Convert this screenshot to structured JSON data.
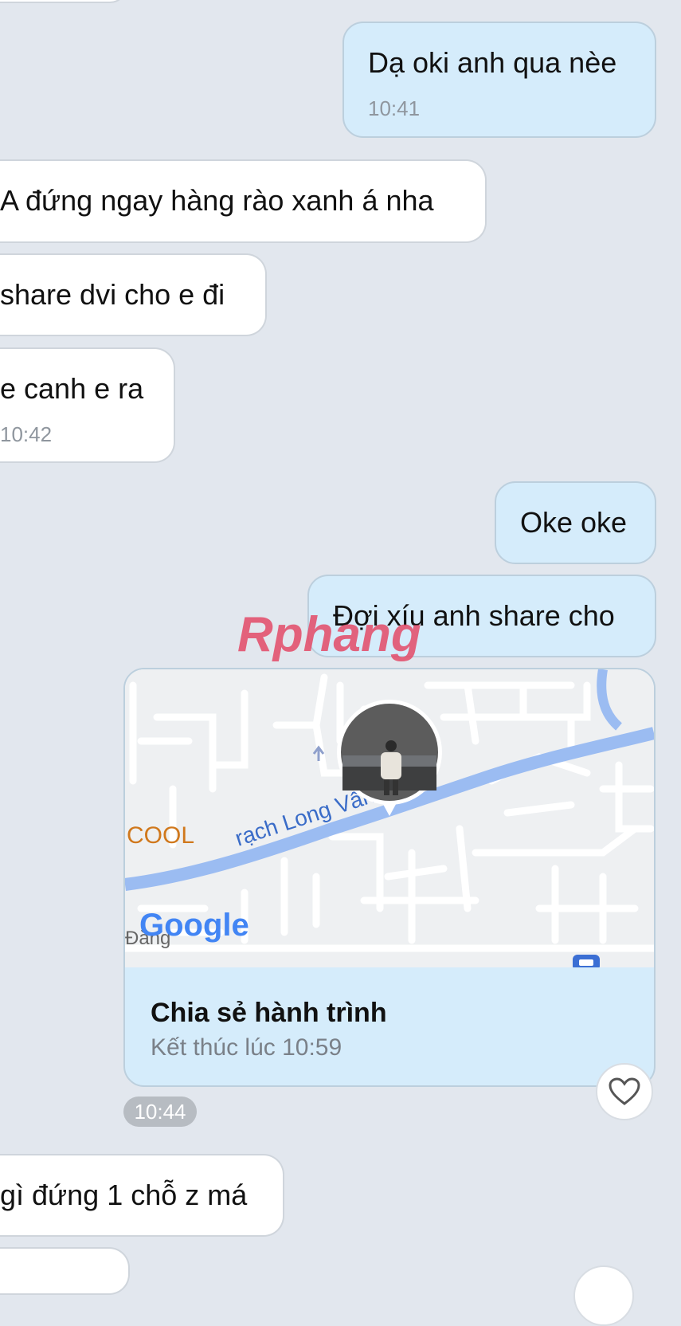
{
  "messages": [
    {
      "text": "Dạ oki anh qua nèe",
      "time": "10:41"
    },
    {
      "text": "A đứng ngay hàng rào xanh á nha"
    },
    {
      "text": "share dvi cho e đi"
    },
    {
      "text": "e canh e ra",
      "time": "10:42"
    },
    {
      "text": "Oke oke"
    },
    {
      "text": "Đợi xíu anh share cho"
    },
    {
      "text": "gì đứng 1 chỗ z má"
    }
  ],
  "location_card": {
    "title": "Chia sẻ hành trình",
    "subtitle": "Kết thúc lúc 10:59",
    "time": "10:44",
    "map_labels": {
      "river": "rạch Long Vân",
      "poi": "COOL",
      "google": "Google",
      "street": "Đằng"
    }
  },
  "watermark": "Rphang",
  "icons": {
    "heart": "heart-icon",
    "avatar": "location-avatar-icon"
  },
  "colors": {
    "outgoing": "#d5ecfb",
    "incoming": "#ffffff",
    "background": "#e2e7ee",
    "river": "#9bbcf2"
  }
}
